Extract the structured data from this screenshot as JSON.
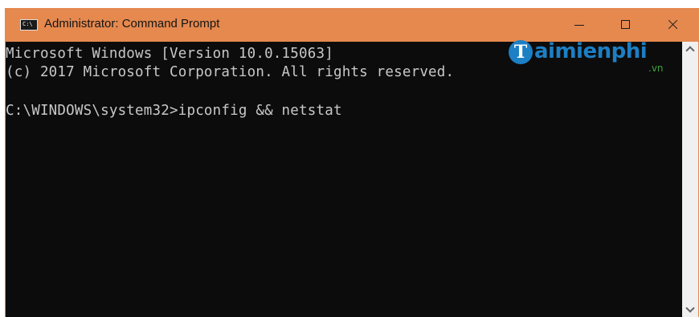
{
  "window": {
    "title": "Administrator: Command Prompt",
    "app_icon_glyph": "C:\\",
    "accent_color": "#e5894f",
    "controls": {
      "minimize": "minimize-icon",
      "maximize": "maximize-icon",
      "close": "close-icon"
    }
  },
  "console": {
    "lines": [
      "Microsoft Windows [Version 10.0.15063]",
      "(c) 2017 Microsoft Corporation. All rights reserved.",
      "C:\\WINDOWS\\system32>ipconfig && netstat"
    ],
    "background": "#0c0c0c",
    "foreground": "#c8c8c8"
  },
  "watermark": {
    "initial": "T",
    "text": "aimienphi",
    "suffix": ".vn"
  }
}
